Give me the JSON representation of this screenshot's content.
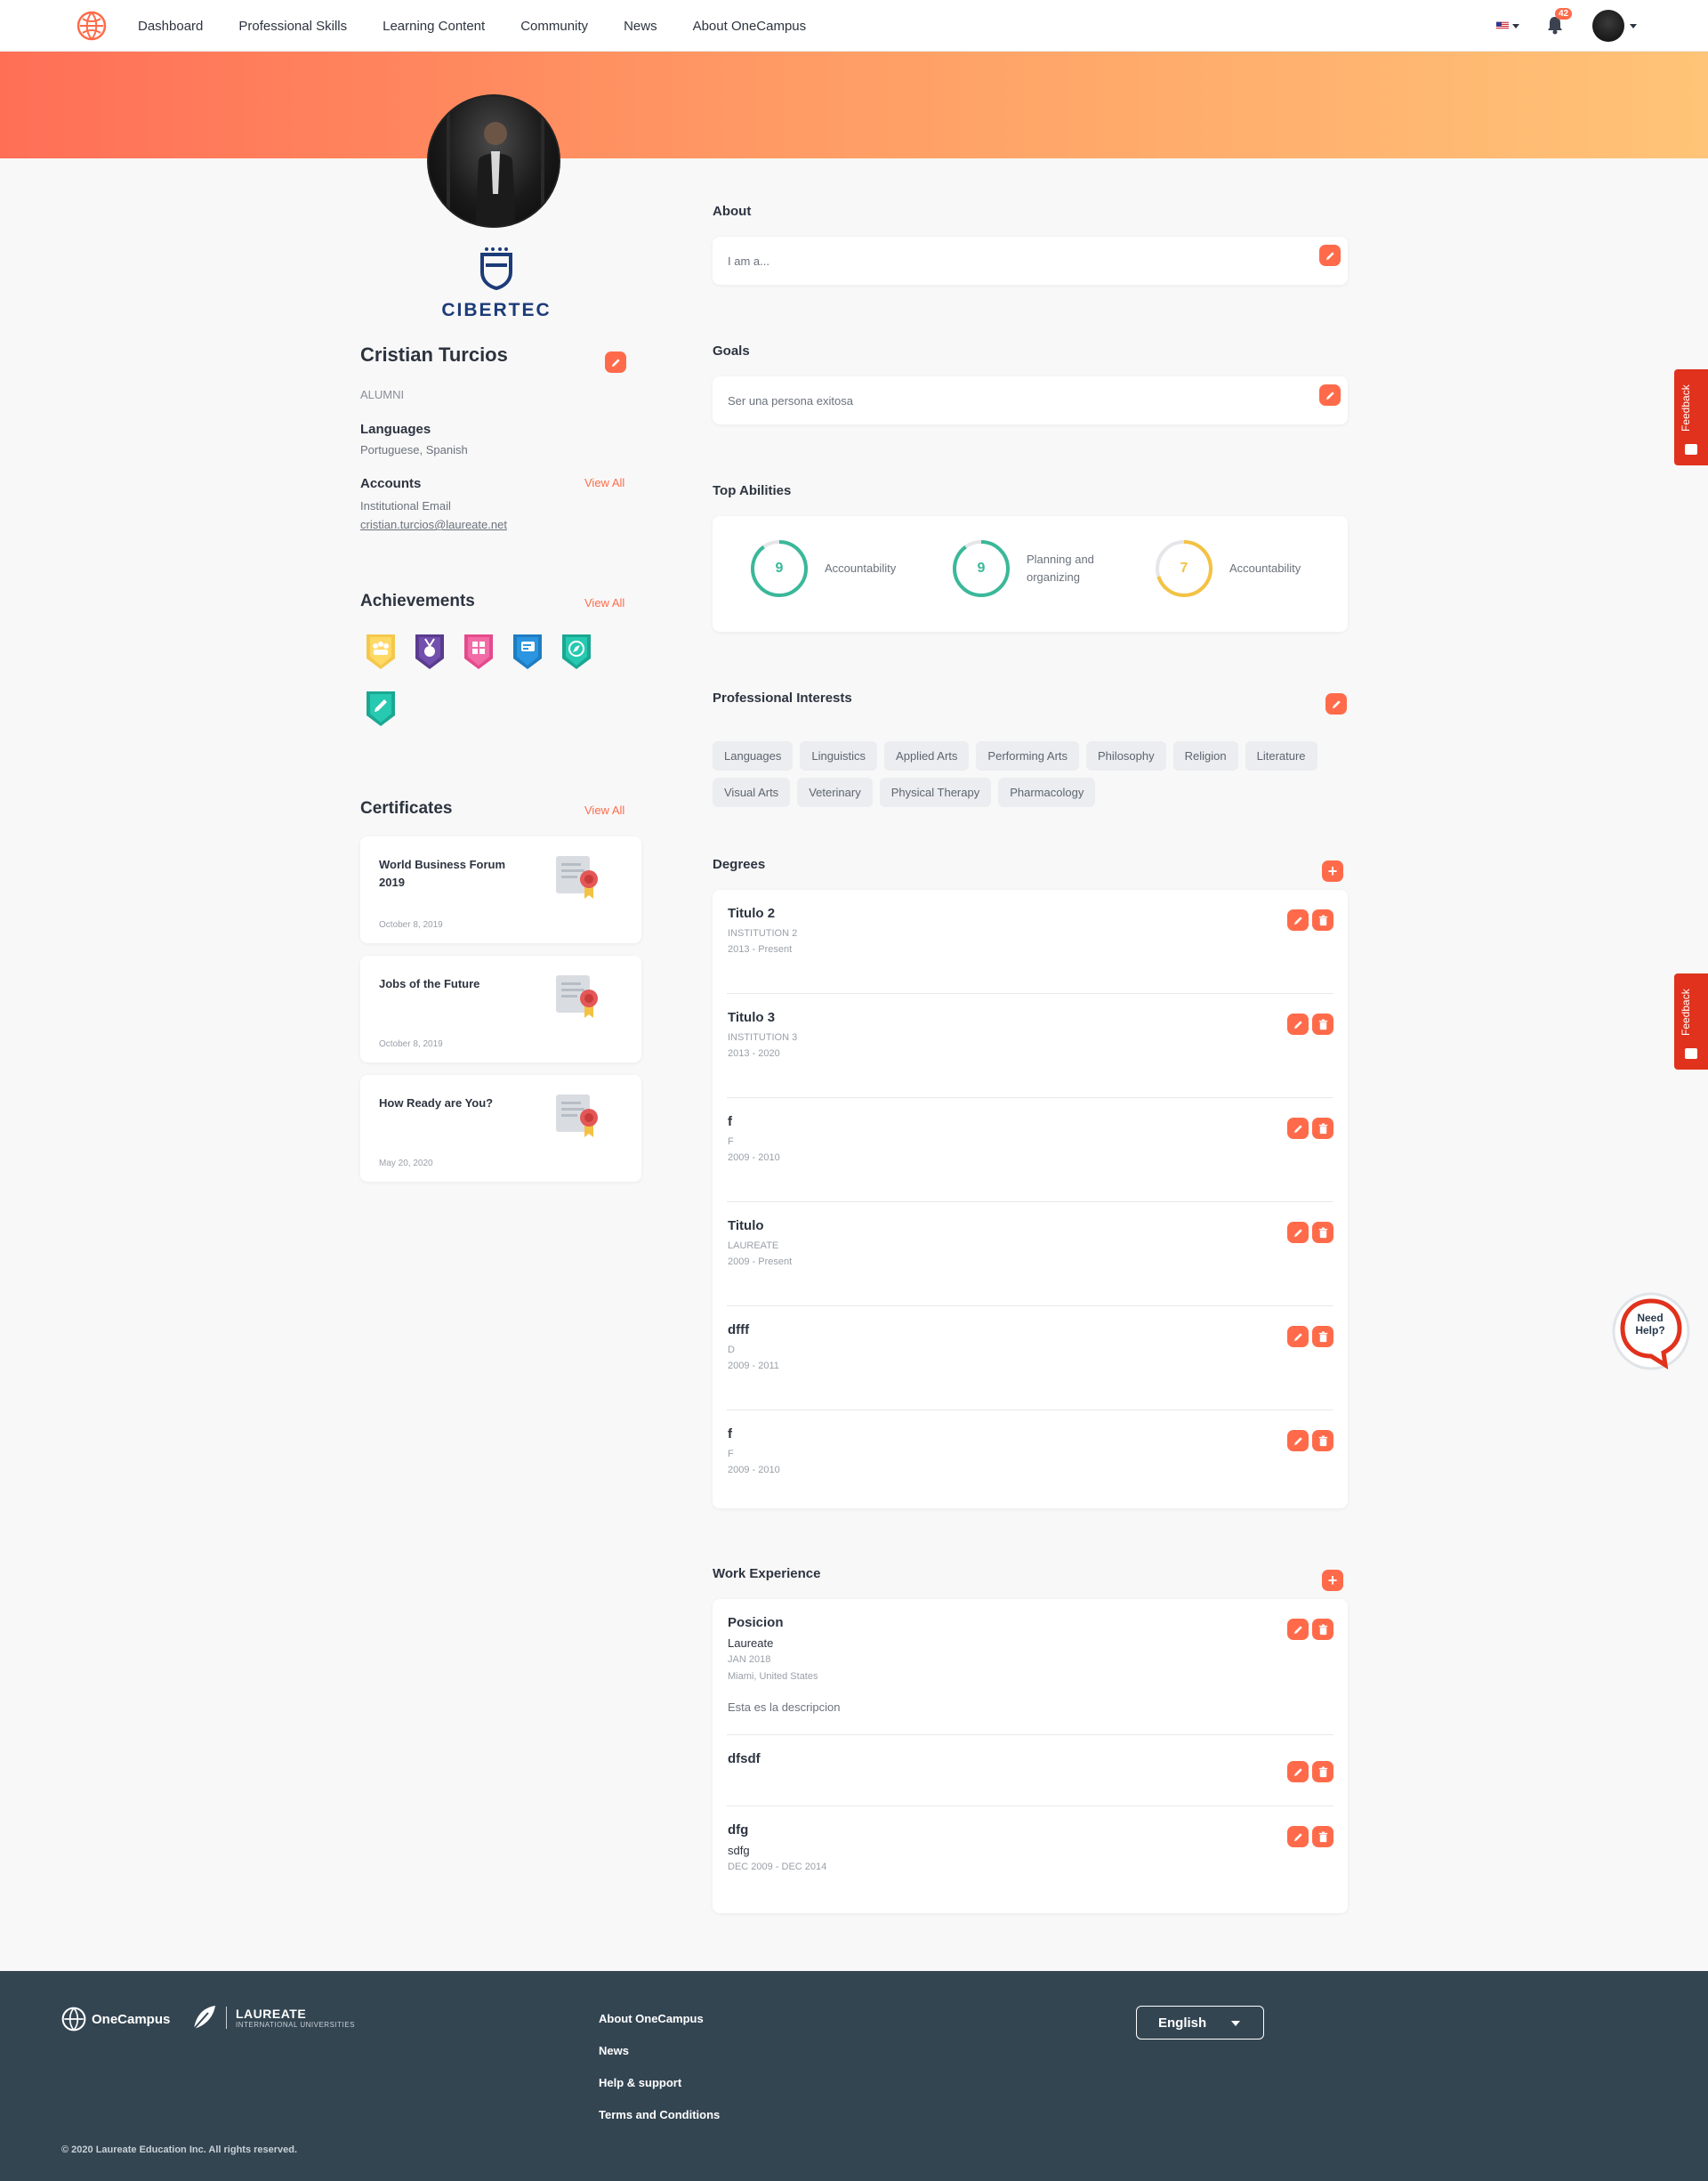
{
  "nav": {
    "links": [
      "Dashboard",
      "Professional Skills",
      "Learning Content",
      "Community",
      "News",
      "About OneCampus"
    ],
    "notification_count": "42"
  },
  "profile": {
    "institution": "CIBERTEC",
    "name": "Cristian Turcios",
    "role": "ALUMNI",
    "languages_label": "Languages",
    "languages_value": "Portuguese, Spanish",
    "accounts_label": "Accounts",
    "view_all": "View All",
    "accounts_type": "Institutional Email",
    "accounts_email": "cristian.turcios@laureate.net"
  },
  "achievements": {
    "title": "Achievements",
    "view_all": "View All",
    "badges": [
      {
        "icon": "team-icon",
        "color": "#f5c84c"
      },
      {
        "icon": "medal-icon",
        "color": "#6b4a9e"
      },
      {
        "icon": "puzzle-icon",
        "color": "#ec5a9a"
      },
      {
        "icon": "chat-icon",
        "color": "#2a8fd6"
      },
      {
        "icon": "compass-icon",
        "color": "#23bfa8"
      },
      {
        "icon": "pencil-icon",
        "color": "#23bfa8"
      }
    ]
  },
  "certificates": {
    "title": "Certificates",
    "view_all": "View All",
    "items": [
      {
        "title": "World Business Forum 2019",
        "date": "October 8, 2019"
      },
      {
        "title": "Jobs of the Future",
        "date": "October 8, 2019"
      },
      {
        "title": "How Ready are You?",
        "date": "May 20, 2020"
      }
    ]
  },
  "about": {
    "title": "About",
    "text": "I am a..."
  },
  "goals": {
    "title": "Goals",
    "text": "Ser una persona exitosa"
  },
  "top_abilities": {
    "title": "Top Abilities",
    "items": [
      {
        "score": "9",
        "label": "Accountability",
        "color": "#3ab89a",
        "fill": 0.9
      },
      {
        "score": "9",
        "label": "Planning and organizing",
        "color": "#3ab89a",
        "fill": 0.9
      },
      {
        "score": "7",
        "label": "Accountability",
        "color": "#f4c243",
        "fill": 0.7
      }
    ]
  },
  "professional_interests": {
    "title": "Professional Interests",
    "chips": [
      "Languages",
      "Linguistics",
      "Applied Arts",
      "Performing Arts",
      "Philosophy",
      "Religion",
      "Literature",
      "Visual Arts",
      "Veterinary",
      "Physical Therapy",
      "Pharmacology"
    ]
  },
  "degrees": {
    "title": "Degrees",
    "add_label": "+",
    "items": [
      {
        "title": "Titulo 2",
        "institution": "INSTITUTION 2",
        "years": "2013 - Present"
      },
      {
        "title": "Titulo 3",
        "institution": "INSTITUTION 3",
        "years": "2013 - 2020"
      },
      {
        "title": "f",
        "institution": "F",
        "years": "2009 - 2010"
      },
      {
        "title": "Titulo",
        "institution": "LAUREATE",
        "years": "2009 - Present"
      },
      {
        "title": "dfff",
        "institution": "D",
        "years": "2009 - 2011"
      },
      {
        "title": "f",
        "institution": "F",
        "years": "2009 - 2010"
      }
    ]
  },
  "work_experience": {
    "title": "Work Experience",
    "add_label": "+",
    "items": [
      {
        "title": "Posicion",
        "company": "Laureate",
        "date": "JAN 2018",
        "location": "Miami, United States",
        "description": "Esta es la descripcion"
      },
      {
        "title": "dfsdf"
      },
      {
        "title": "dfg",
        "company": "sdfg",
        "date": "DEC 2009 - DEC 2014"
      }
    ]
  },
  "feedback_label": "Feedback",
  "need_help": {
    "line1": "Need",
    "line2": "Help?"
  },
  "footer": {
    "brand1": "OneCampus",
    "brand2": "LAUREATE",
    "brand2_sub": "INTERNATIONAL UNIVERSITIES",
    "links": [
      "About OneCampus",
      "News",
      "Help & support",
      "Terms and Conditions"
    ],
    "language": "English",
    "copyright": "© 2020 Laureate Education Inc. All rights reserved."
  }
}
